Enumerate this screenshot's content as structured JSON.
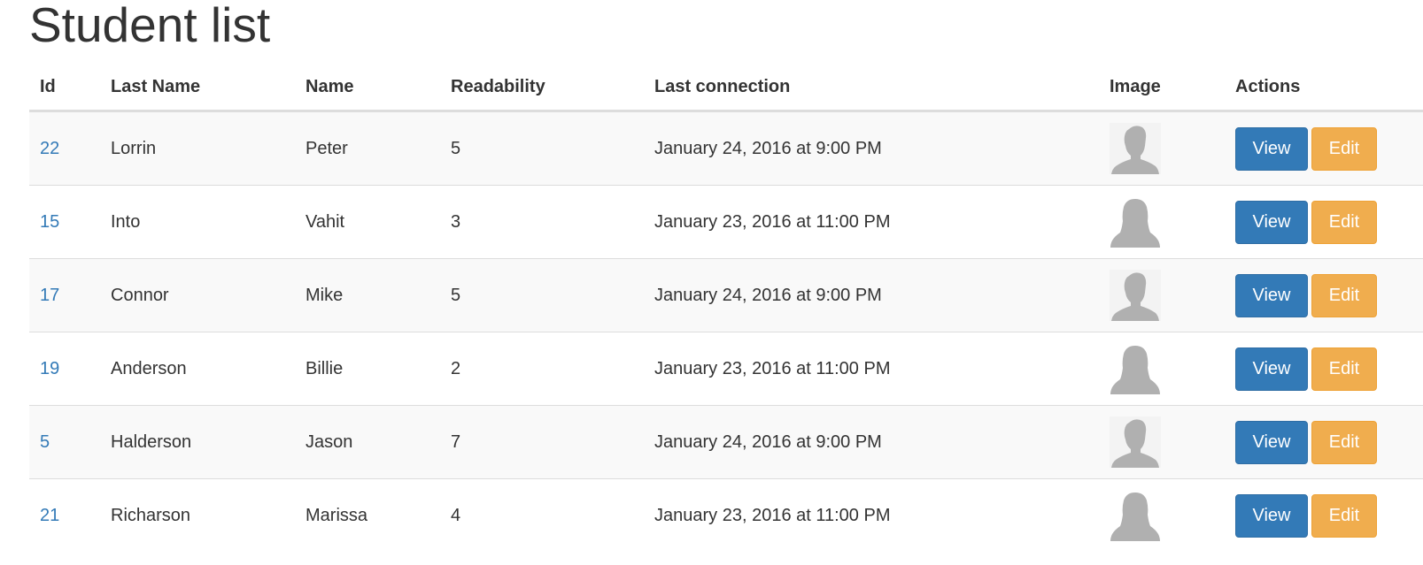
{
  "page_title": "Student list",
  "table": {
    "columns": [
      "Id",
      "Last Name",
      "Name",
      "Readability",
      "Last connection",
      "Image",
      "Actions"
    ],
    "rows": [
      {
        "id": "22",
        "last_name": "Lorrin",
        "name": "Peter",
        "readability": "5",
        "last_connection": "January 24, 2016 at 9:00 PM",
        "avatar": "male-avatar-icon",
        "view_label": "View",
        "edit_label": "Edit"
      },
      {
        "id": "15",
        "last_name": "Into",
        "name": "Vahit",
        "readability": "3",
        "last_connection": "January 23, 2016 at 11:00 PM",
        "avatar": "female-avatar-icon",
        "view_label": "View",
        "edit_label": "Edit"
      },
      {
        "id": "17",
        "last_name": "Connor",
        "name": "Mike",
        "readability": "5",
        "last_connection": "January 24, 2016 at 9:00 PM",
        "avatar": "male-avatar-icon",
        "view_label": "View",
        "edit_label": "Edit"
      },
      {
        "id": "19",
        "last_name": "Anderson",
        "name": "Billie",
        "readability": "2",
        "last_connection": "January 23, 2016 at 11:00 PM",
        "avatar": "female-avatar-icon",
        "view_label": "View",
        "edit_label": "Edit"
      },
      {
        "id": "5",
        "last_name": "Halderson",
        "name": "Jason",
        "readability": "7",
        "last_connection": "January 24, 2016 at 9:00 PM",
        "avatar": "male-avatar-icon",
        "view_label": "View",
        "edit_label": "Edit"
      },
      {
        "id": "21",
        "last_name": "Richarson",
        "name": "Marissa",
        "readability": "4",
        "last_connection": "January 23, 2016 at 11:00 PM",
        "avatar": "female-avatar-icon",
        "view_label": "View",
        "edit_label": "Edit"
      }
    ]
  },
  "colors": {
    "link": "#337ab7",
    "view_button": "#337ab7",
    "edit_button": "#f0ad4e",
    "stripe": "#f9f9f9",
    "avatar_fill": "#b0b0b0"
  }
}
